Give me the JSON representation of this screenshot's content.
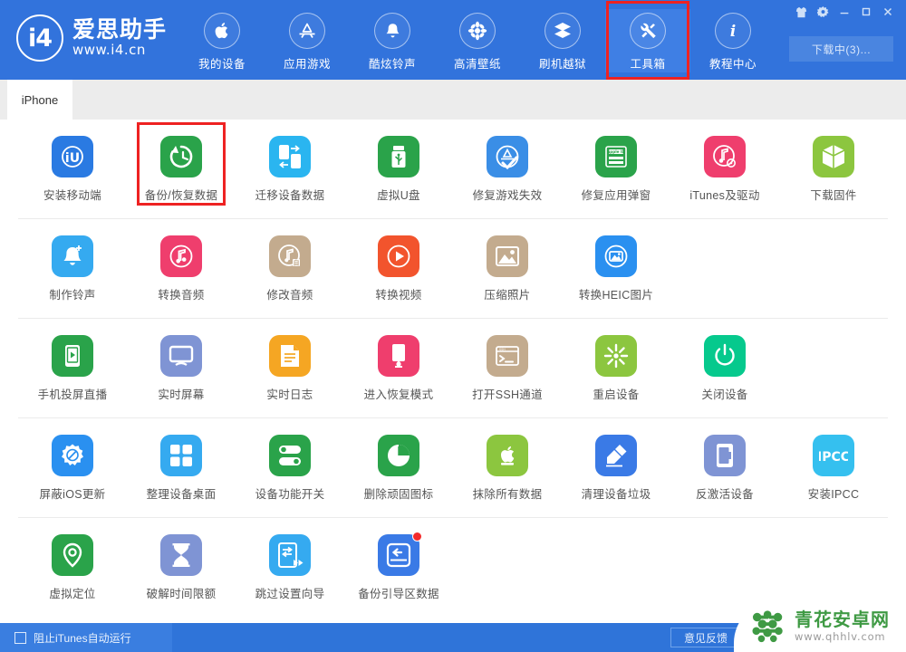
{
  "brand": {
    "mark_glyph": "i4",
    "name_cn": "爱思助手",
    "url": "www.i4.cn"
  },
  "window": {
    "buttons": [
      {
        "name": "skin-icon",
        "glyph": "shirt"
      },
      {
        "name": "settings-gear-icon",
        "glyph": "gear"
      },
      {
        "name": "minimize-button",
        "glyph": "minimize"
      },
      {
        "name": "maximize-button",
        "glyph": "maximize"
      },
      {
        "name": "close-button",
        "glyph": "close"
      }
    ],
    "download_label": "下载中(3)..."
  },
  "nav": {
    "items": [
      {
        "label": "我的设备",
        "icon": "apple-icon",
        "highlighted": false
      },
      {
        "label": "应用游戏",
        "icon": "appstore-icon",
        "highlighted": false
      },
      {
        "label": "酷炫铃声",
        "icon": "bell-icon",
        "highlighted": false
      },
      {
        "label": "高清壁纸",
        "icon": "flower-icon",
        "highlighted": false
      },
      {
        "label": "刷机越狱",
        "icon": "box-stack-icon",
        "highlighted": false
      },
      {
        "label": "工具箱",
        "icon": "tools-icon",
        "highlighted": true
      },
      {
        "label": "教程中心",
        "icon": "info-icon",
        "highlighted": false
      }
    ]
  },
  "tabs": [
    {
      "label": "iPhone",
      "active": true
    }
  ],
  "toolbox": {
    "rows": [
      [
        {
          "label": "安装移动端",
          "icon": "i4-app-icon",
          "color": "#2a7ae2",
          "highlighted": false,
          "badge": false
        },
        {
          "label": "备份/恢复数据",
          "icon": "backup-restore-icon",
          "color": "#2aa34a",
          "highlighted": true,
          "badge": false
        },
        {
          "label": "迁移设备数据",
          "icon": "device-migrate-icon",
          "color": "#2ab5f0",
          "highlighted": false,
          "badge": false
        },
        {
          "label": "虚拟U盘",
          "icon": "usb-drive-icon",
          "color": "#2aa34a",
          "highlighted": false,
          "badge": false
        },
        {
          "label": "修复游戏失效",
          "icon": "appstore-fix-icon",
          "color": "#3a8ee6",
          "highlighted": false,
          "badge": false
        },
        {
          "label": "修复应用弹窗",
          "icon": "apple-id-icon",
          "color": "#2aa34a",
          "highlighted": false,
          "badge": false
        },
        {
          "label": "iTunes及驱动",
          "icon": "itunes-driver-icon",
          "color": "#ef3e6d",
          "highlighted": false,
          "badge": false
        },
        {
          "label": "下载固件",
          "icon": "firmware-box-icon",
          "color": "#8cc63f",
          "highlighted": false,
          "badge": false
        }
      ],
      [
        {
          "label": "制作铃声",
          "icon": "ringtone-make-icon",
          "color": "#35aaf0",
          "highlighted": false,
          "badge": false
        },
        {
          "label": "转换音频",
          "icon": "audio-convert-icon",
          "color": "#ef3e6d",
          "highlighted": false,
          "badge": false
        },
        {
          "label": "修改音频",
          "icon": "audio-edit-icon",
          "color": "#c3ab8e",
          "highlighted": false,
          "badge": false
        },
        {
          "label": "转换视频",
          "icon": "video-convert-icon",
          "color": "#f2542d",
          "highlighted": false,
          "badge": false
        },
        {
          "label": "压缩照片",
          "icon": "photo-compress-icon",
          "color": "#c3ab8e",
          "highlighted": false,
          "badge": false
        },
        {
          "label": "转换HEIC图片",
          "icon": "heic-convert-icon",
          "color": "#2a90f0",
          "highlighted": false,
          "badge": false
        }
      ],
      [
        {
          "label": "手机投屏直播",
          "icon": "screen-broadcast-icon",
          "color": "#2aa34a",
          "highlighted": false,
          "badge": false
        },
        {
          "label": "实时屏幕",
          "icon": "live-screen-icon",
          "color": "#7f94d4",
          "highlighted": false,
          "badge": false
        },
        {
          "label": "实时日志",
          "icon": "live-log-icon",
          "color": "#f5a623",
          "highlighted": false,
          "badge": false
        },
        {
          "label": "进入恢复模式",
          "icon": "recovery-mode-icon",
          "color": "#ef3e6d",
          "highlighted": false,
          "badge": false
        },
        {
          "label": "打开SSH通道",
          "icon": "ssh-terminal-icon",
          "color": "#c3ab8e",
          "highlighted": false,
          "badge": false
        },
        {
          "label": "重启设备",
          "icon": "restart-device-icon",
          "color": "#8cc63f",
          "highlighted": false,
          "badge": false
        },
        {
          "label": "关闭设备",
          "icon": "power-off-icon",
          "color": "#06c98d",
          "highlighted": false,
          "badge": false
        }
      ],
      [
        {
          "label": "屏蔽iOS更新",
          "icon": "block-update-icon",
          "color": "#2a90f0",
          "highlighted": false,
          "badge": false
        },
        {
          "label": "整理设备桌面",
          "icon": "organize-desktop-icon",
          "color": "#35aaf0",
          "highlighted": false,
          "badge": false
        },
        {
          "label": "设备功能开关",
          "icon": "feature-toggle-icon",
          "color": "#2aa34a",
          "highlighted": false,
          "badge": false
        },
        {
          "label": "删除顽固图标",
          "icon": "delete-icon-icon",
          "color": "#2aa34a",
          "highlighted": false,
          "badge": false
        },
        {
          "label": "抹除所有数据",
          "icon": "erase-all-icon",
          "color": "#8cc63f",
          "highlighted": false,
          "badge": false
        },
        {
          "label": "清理设备垃圾",
          "icon": "clean-junk-icon",
          "color": "#3a7ae6",
          "highlighted": false,
          "badge": false
        },
        {
          "label": "反激活设备",
          "icon": "deactivate-icon",
          "color": "#7f94d4",
          "highlighted": false,
          "badge": false
        },
        {
          "label": "安装IPCC",
          "icon": "ipcc-install-icon",
          "color": "#35c0ef",
          "highlighted": false,
          "badge": false
        }
      ],
      [
        {
          "label": "虚拟定位",
          "icon": "virtual-location-icon",
          "color": "#2aa34a",
          "highlighted": false,
          "badge": false
        },
        {
          "label": "破解时间限额",
          "icon": "hourglass-icon",
          "color": "#7f94d4",
          "highlighted": false,
          "badge": false
        },
        {
          "label": "跳过设置向导",
          "icon": "skip-setup-icon",
          "color": "#35aaf0",
          "highlighted": false,
          "badge": false
        },
        {
          "label": "备份引导区数据",
          "icon": "backup-boot-icon",
          "color": "#3a7ae6",
          "highlighted": false,
          "badge": true
        }
      ]
    ]
  },
  "statusbar": {
    "block_itunes_label": "阻止iTunes自动运行",
    "block_itunes_checked": false,
    "feedback_label": "意见反馈"
  },
  "watermark": {
    "title": "青花安卓网",
    "url": "www.qhhlv.com"
  },
  "colors": {
    "header_blue": "#3273dc",
    "statusbar_blue": "#2f74d9",
    "highlight_red": "#ee2222",
    "accent_green": "#3f9a44"
  }
}
